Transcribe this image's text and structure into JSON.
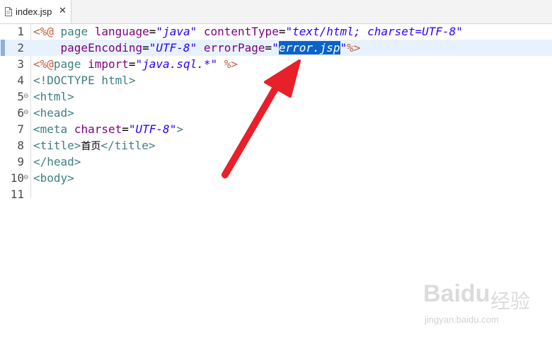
{
  "tab": {
    "filename": "index.jsp",
    "close": "✕"
  },
  "lines": [
    {
      "num": "1",
      "fold": ""
    },
    {
      "num": "2",
      "fold": ""
    },
    {
      "num": "3",
      "fold": ""
    },
    {
      "num": "4",
      "fold": ""
    },
    {
      "num": "5",
      "fold": "⊖"
    },
    {
      "num": "6",
      "fold": "⊖"
    },
    {
      "num": "7",
      "fold": ""
    },
    {
      "num": "8",
      "fold": ""
    },
    {
      "num": "9",
      "fold": ""
    },
    {
      "num": "10",
      "fold": "⊖"
    },
    {
      "num": "11",
      "fold": ""
    }
  ],
  "code": {
    "l1": {
      "open": "<%@",
      "page": "page",
      "lang_attr": "language",
      "eq1": "=",
      "lang_val": "\"java\"",
      "ct_attr": "contentType",
      "eq2": "=",
      "ct_val": "\"text/html; charset=UTF-8\""
    },
    "l2": {
      "pe_attr": "pageEncoding",
      "eq1": "=",
      "pe_val": "\"UTF-8\"",
      "ep_attr": "errorPage",
      "eq2": "=",
      "q1": "\"",
      "ep_val": "error.jsp",
      "q2": "\"",
      "close": "%>"
    },
    "l3": {
      "open": "<%@",
      "page": "page",
      "imp_attr": "import",
      "eq": "=",
      "imp_val": "\"java.sql.*\"",
      "close": "%>"
    },
    "l4": {
      "text": "<!DOCTYPE html>"
    },
    "l5": {
      "text": "<html>"
    },
    "l6": {
      "text": "<head>"
    },
    "l7": {
      "tag": "<meta",
      "attr": "charset",
      "eq": "=",
      "val": "\"UTF-8\"",
      "end": ">"
    },
    "l8": {
      "open": "<title>",
      "content": "首页",
      "close": "</title>"
    },
    "l9": {
      "text": "</head>"
    },
    "l10": {
      "text": "<body>"
    },
    "l11": {
      "text": ""
    }
  },
  "colors": {
    "arrow": "#e8202a",
    "selection": "#0a63c6",
    "current_line": "#e8f2fe"
  },
  "watermark": {
    "brand": "Baidu",
    "cn": "经验",
    "url": "jingyan.baidu.com"
  }
}
